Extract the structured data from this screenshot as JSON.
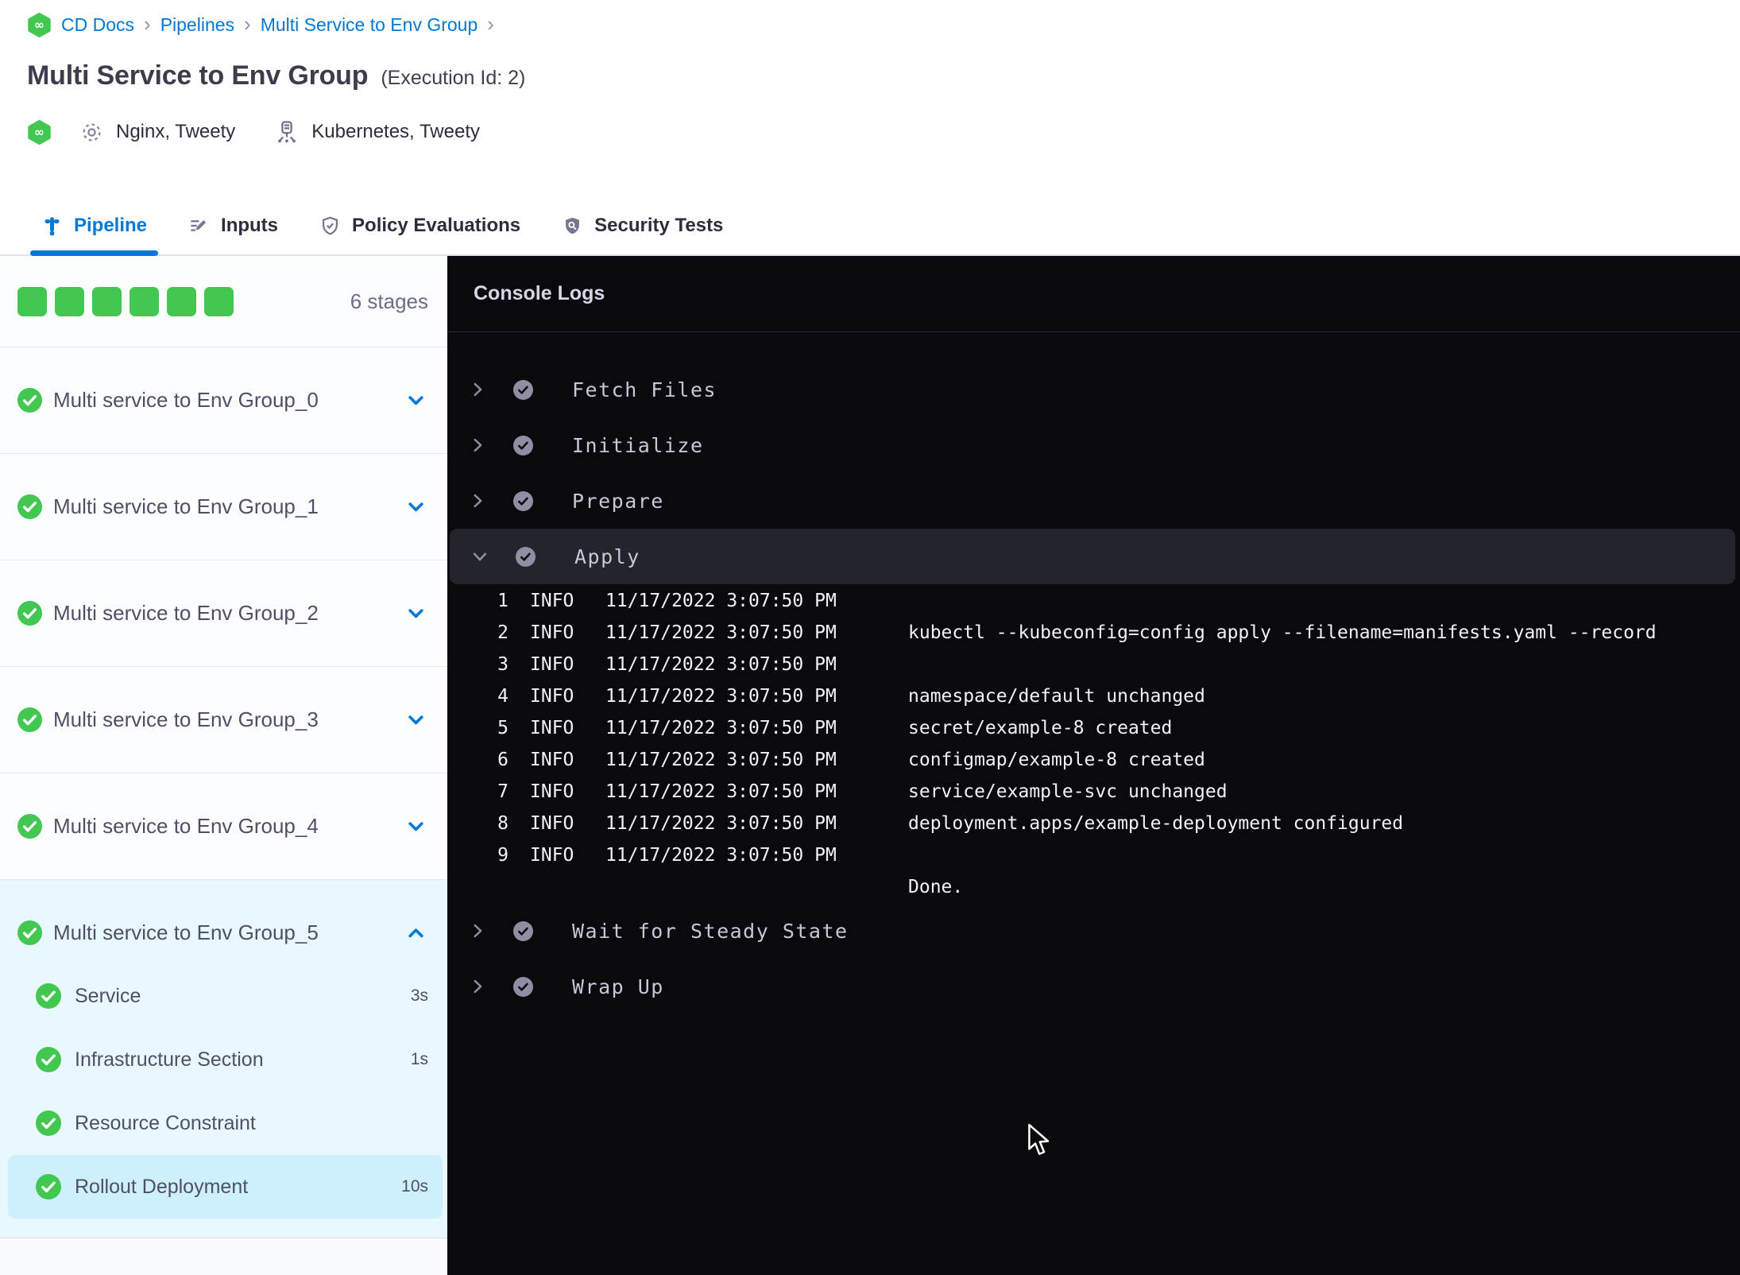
{
  "breadcrumb": {
    "items": [
      {
        "label": "CD Docs"
      },
      {
        "label": "Pipelines"
      },
      {
        "label": "Multi Service to Env Group"
      }
    ],
    "separator": "›"
  },
  "header": {
    "title": "Multi Service to Env Group",
    "execution_id": "(Execution Id: 2)",
    "services_label": "Nginx, Tweety",
    "environments_label": "Kubernetes, Tweety"
  },
  "tabs": [
    {
      "label": "Pipeline",
      "active": true
    },
    {
      "label": "Inputs",
      "active": false
    },
    {
      "label": "Policy Evaluations",
      "active": false
    },
    {
      "label": "Security Tests",
      "active": false
    }
  ],
  "stages_panel": {
    "stages_count_label": "6 stages",
    "progress": [
      {
        "status": "success"
      },
      {
        "status": "success"
      },
      {
        "status": "success"
      },
      {
        "status": "success"
      },
      {
        "status": "success"
      },
      {
        "status": "success"
      }
    ],
    "stages": [
      {
        "name": "Multi service to Env Group_0"
      },
      {
        "name": "Multi service to Env Group_1"
      },
      {
        "name": "Multi service to Env Group_2"
      },
      {
        "name": "Multi service to Env Group_3"
      },
      {
        "name": "Multi service to Env Group_4"
      }
    ],
    "expanded_stage": {
      "name": "Multi service to Env Group_5",
      "steps": [
        {
          "label": "Service",
          "duration": "3s"
        },
        {
          "label": "Infrastructure Section",
          "duration": "1s"
        },
        {
          "label": "Resource Constraint",
          "duration": ""
        },
        {
          "label": "Rollout Deployment",
          "duration": "10s",
          "selected": true
        }
      ]
    }
  },
  "console": {
    "title": "Console Logs",
    "sections": {
      "fetch_files": "Fetch Files",
      "initialize": "Initialize",
      "prepare": "Prepare",
      "apply": "Apply",
      "wait_for_steady_state": "Wait for Steady State",
      "wrap_up": "Wrap Up"
    },
    "log_lines": [
      {
        "num": "1",
        "level": "INFO",
        "time": "11/17/2022 3:07:50 PM",
        "msg": ""
      },
      {
        "num": "2",
        "level": "INFO",
        "time": "11/17/2022 3:07:50 PM",
        "msg": "kubectl --kubeconfig=config apply --filename=manifests.yaml --record"
      },
      {
        "num": "3",
        "level": "INFO",
        "time": "11/17/2022 3:07:50 PM",
        "msg": ""
      },
      {
        "num": "4",
        "level": "INFO",
        "time": "11/17/2022 3:07:50 PM",
        "msg": "namespace/default unchanged"
      },
      {
        "num": "5",
        "level": "INFO",
        "time": "11/17/2022 3:07:50 PM",
        "msg": "secret/example-8 created"
      },
      {
        "num": "6",
        "level": "INFO",
        "time": "11/17/2022 3:07:50 PM",
        "msg": "configmap/example-8 created"
      },
      {
        "num": "7",
        "level": "INFO",
        "time": "11/17/2022 3:07:50 PM",
        "msg": "service/example-svc unchanged"
      },
      {
        "num": "8",
        "level": "INFO",
        "time": "11/17/2022 3:07:50 PM",
        "msg": "deployment.apps/example-deployment configured"
      },
      {
        "num": "9",
        "level": "INFO",
        "time": "11/17/2022 3:07:50 PM",
        "msg": ""
      },
      {
        "num": "",
        "level": "",
        "time": "",
        "msg": "Done."
      }
    ]
  },
  "colors": {
    "accent_blue": "#0278d5",
    "success_green": "#42c750",
    "selected_step_bg": "#cdf0fc",
    "expanded_group_bg": "#e8f8fe",
    "console_bg": "#0a0a0e",
    "console_highlight": "#24242d"
  }
}
